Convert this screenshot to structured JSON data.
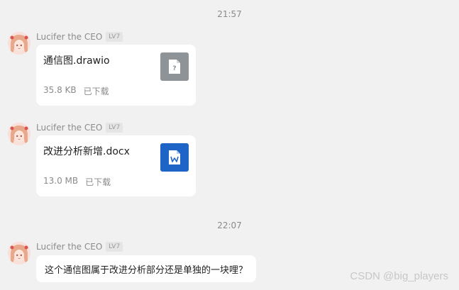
{
  "chat": {
    "messages": [
      {
        "timestamp": "21:57",
        "sender": {
          "name": "Lucifer the CEO",
          "level": "LV7"
        },
        "type": "file",
        "file": {
          "name": "通信图.drawio",
          "size": "35.8 KB",
          "status": "已下载",
          "icon": "unknown-file-icon"
        }
      },
      {
        "sender": {
          "name": "Lucifer the CEO",
          "level": "LV7"
        },
        "type": "file",
        "file": {
          "name": "改进分析新增.docx",
          "size": "13.0 MB",
          "status": "已下载",
          "icon": "word-file-icon"
        }
      },
      {
        "timestamp": "22:07",
        "sender": {
          "name": "Lucifer the CEO",
          "level": "LV7"
        },
        "type": "text",
        "text": "这个通信图属于改进分析部分还是单独的一块哩？"
      }
    ]
  },
  "watermark": "CSDN @big_players",
  "colors": {
    "background": "#f1f1f1",
    "bubble": "#ffffff",
    "word_icon": "#1e63c6",
    "unknown_icon": "#8e9398"
  }
}
